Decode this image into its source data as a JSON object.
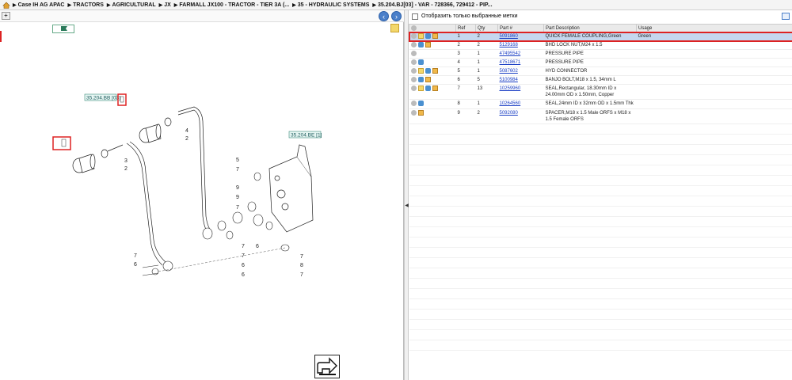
{
  "breadcrumb": {
    "items": [
      "Case IH AG APAC",
      "TRACTORS",
      "AGRICULTURAL",
      "JX",
      "FARMALL JX100 - TRACTOR - TIER 3A (...",
      "35 - HYDRAULIC SYSTEMS",
      "35.204.BJ[03] - VAR - 728366, 729412 - PIP..."
    ]
  },
  "diagram": {
    "refs": [
      "35.204.BB [03]",
      "35.204.BE [1]"
    ],
    "callouts": [
      "3",
      "2",
      "4",
      "2",
      "5",
      "7",
      "9",
      "9",
      "7",
      "7",
      "7",
      "6",
      "6",
      "6",
      "7",
      "8",
      "7",
      "7",
      "6"
    ],
    "icons": [
      "plus-icon",
      "prev-arrow-icon",
      "next-arrow-icon",
      "flag-icon",
      "note-icon",
      "next-page-icon"
    ]
  },
  "filter": {
    "label": "Отобразить только выбранные метки"
  },
  "table": {
    "headers": [
      "",
      "Ref",
      "Qty",
      "Part #",
      "Part Description",
      "Usage"
    ],
    "rows": [
      {
        "ref": "1",
        "qty": "2",
        "part": "5091860",
        "desc": "QUICK FEMALE COUPLING,Green",
        "usage": "Green",
        "icons": [
          "info",
          "note",
          "link",
          "box"
        ],
        "selected": true
      },
      {
        "ref": "2",
        "qty": "2",
        "part": "5129168",
        "desc": "BHD LOCK NUT,M24 x 1.5",
        "usage": "",
        "icons": [
          "info",
          "link",
          "box"
        ]
      },
      {
        "ref": "3",
        "qty": "1",
        "part": "47495542",
        "desc": "PRESSURE PIPE",
        "usage": "",
        "icons": [
          "info"
        ]
      },
      {
        "ref": "4",
        "qty": "1",
        "part": "47518671",
        "desc": "PRESSURE PIPE",
        "usage": "",
        "icons": [
          "info",
          "link"
        ]
      },
      {
        "ref": "5",
        "qty": "1",
        "part": "5087602",
        "desc": "HYD CONNECTOR",
        "usage": "",
        "icons": [
          "info",
          "note",
          "link",
          "box"
        ]
      },
      {
        "ref": "6",
        "qty": "5",
        "part": "5100984",
        "desc": "BANJO BOLT,M18 x 1.5, 34mm L",
        "usage": "",
        "icons": [
          "info",
          "link",
          "box"
        ]
      },
      {
        "ref": "7",
        "qty": "13",
        "part": "10259960",
        "desc": "SEAL,Rectangular, 18.30mm ID x 24.00mm OD x 1.50mm, Copper",
        "usage": "",
        "icons": [
          "info",
          "note",
          "link",
          "box"
        ]
      },
      {
        "ref": "8",
        "qty": "1",
        "part": "10264560",
        "desc": "SEAL,24mm ID x 32mm OD x 1.5mm Thk",
        "usage": "",
        "icons": [
          "info",
          "link"
        ]
      },
      {
        "ref": "9",
        "qty": "2",
        "part": "5092080",
        "desc": "SPACER,M18 x 1.5 Male ORFS x M18 x 1.5 Female ORFS",
        "usage": "",
        "icons": [
          "info",
          "box"
        ]
      }
    ]
  }
}
